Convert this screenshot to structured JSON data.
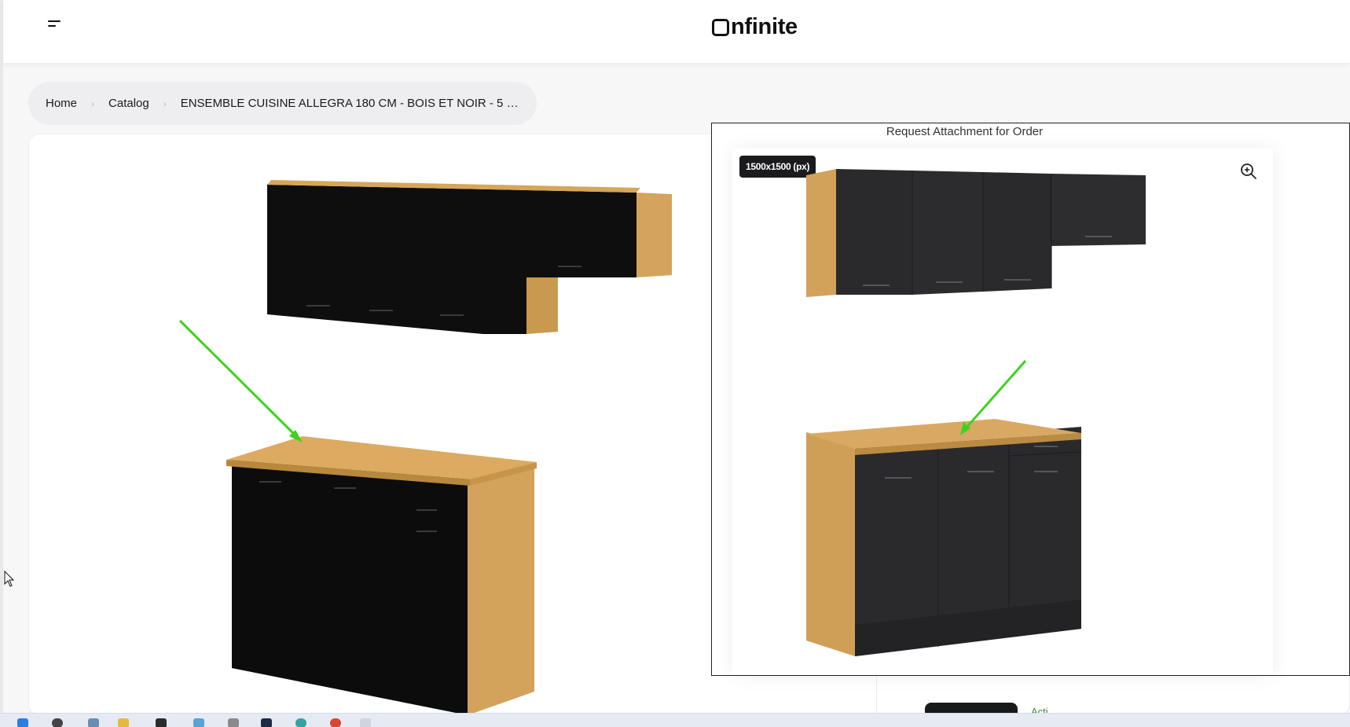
{
  "header": {
    "logo_text": "nfinite"
  },
  "breadcrumb": {
    "items": [
      "Home",
      "Catalog"
    ],
    "current": "ENSEMBLE CUISINE ALLEGRA 180 CM - BOIS ET NOIR - 5 C..."
  },
  "viewer": {
    "title": "Request Attachment for Order",
    "size_badge": "1500x1500 (px)"
  },
  "bottom": {
    "partial_label": "Acti"
  },
  "colors": {
    "wood": "#d9aa5e",
    "cabinet_black": "#111111",
    "viewer_cabinet": "#2a2a2c",
    "arrow_green": "#3ed21f"
  },
  "icons": {
    "menu": "menu-icon",
    "zoom": "zoom-in-icon",
    "breadcrumb_separator": "chevron-right-icon",
    "cursor": "mouse-cursor-icon"
  }
}
